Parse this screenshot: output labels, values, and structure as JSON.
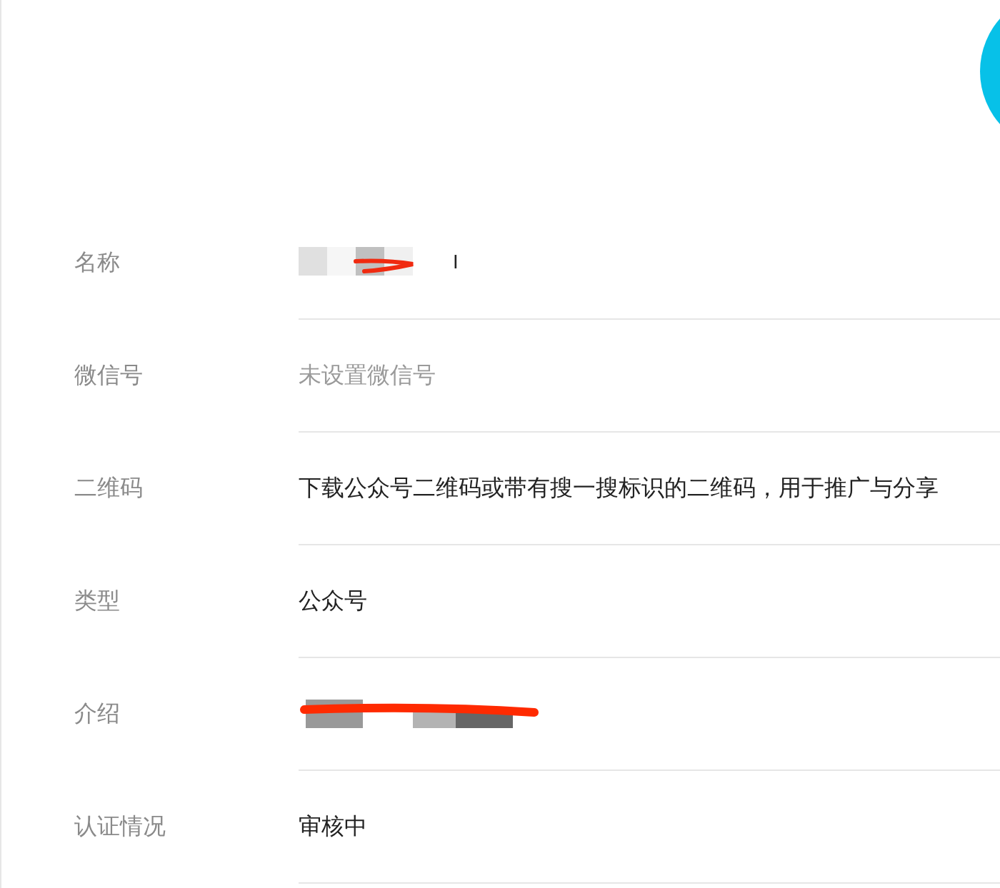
{
  "avatar": {
    "color": "#07c1e8"
  },
  "fields": [
    {
      "label": "名称",
      "kind": "redacted",
      "value": "I"
    },
    {
      "label": "微信号",
      "kind": "placeholder",
      "placeholder": "未设置微信号"
    },
    {
      "label": "二维码",
      "kind": "text",
      "value": "下载公众号二维码或带有搜一搜标识的二维码，用于推广与分享"
    },
    {
      "label": "类型",
      "kind": "text",
      "value": "公众号"
    },
    {
      "label": "介绍",
      "kind": "redacted"
    },
    {
      "label": "认证情况",
      "kind": "text",
      "value": "审核中"
    }
  ]
}
